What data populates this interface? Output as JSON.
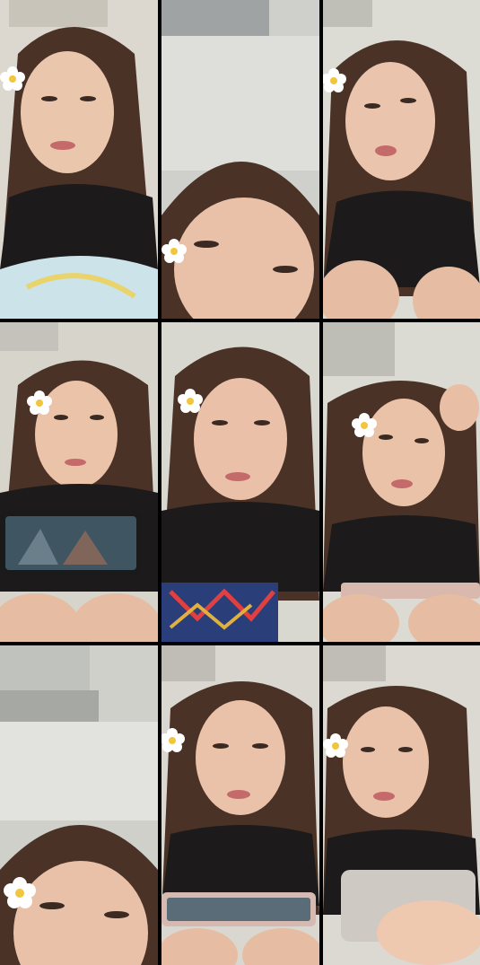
{
  "grid": {
    "rows": 3,
    "columns": 3,
    "tiles": [
      {
        "id": 1,
        "subject": "face-with-flower-hairclip",
        "props": [
          "pillow"
        ]
      },
      {
        "id": 2,
        "subject": "forehead-closeup",
        "props": [
          "air-conditioner"
        ]
      },
      {
        "id": 3,
        "subject": "face-tongue-out",
        "props": [
          "air-conditioner"
        ]
      },
      {
        "id": 4,
        "subject": "face-holding-phone",
        "props": [
          "air-conditioner",
          "phone-game"
        ]
      },
      {
        "id": 5,
        "subject": "face-pouting",
        "props": [
          "patterned-cloth"
        ]
      },
      {
        "id": 6,
        "subject": "face-hand-in-hair",
        "props": [
          "air-conditioner",
          "phone"
        ]
      },
      {
        "id": 7,
        "subject": "lower-face-closeup",
        "props": [
          "air-conditioner"
        ]
      },
      {
        "id": 8,
        "subject": "face-holding-phone",
        "props": [
          "air-conditioner",
          "phone"
        ]
      },
      {
        "id": 9,
        "subject": "face-holding-phone",
        "props": [
          "air-conditioner",
          "phone"
        ]
      }
    ]
  },
  "colors": {
    "background": "#000000",
    "wall": "#d9d6cf",
    "hair": "#4a3226",
    "skin": "#e8c0a6",
    "shirt": "#1c1a1a",
    "flower": "#ffffff",
    "flower_center": "#f2c53d"
  }
}
